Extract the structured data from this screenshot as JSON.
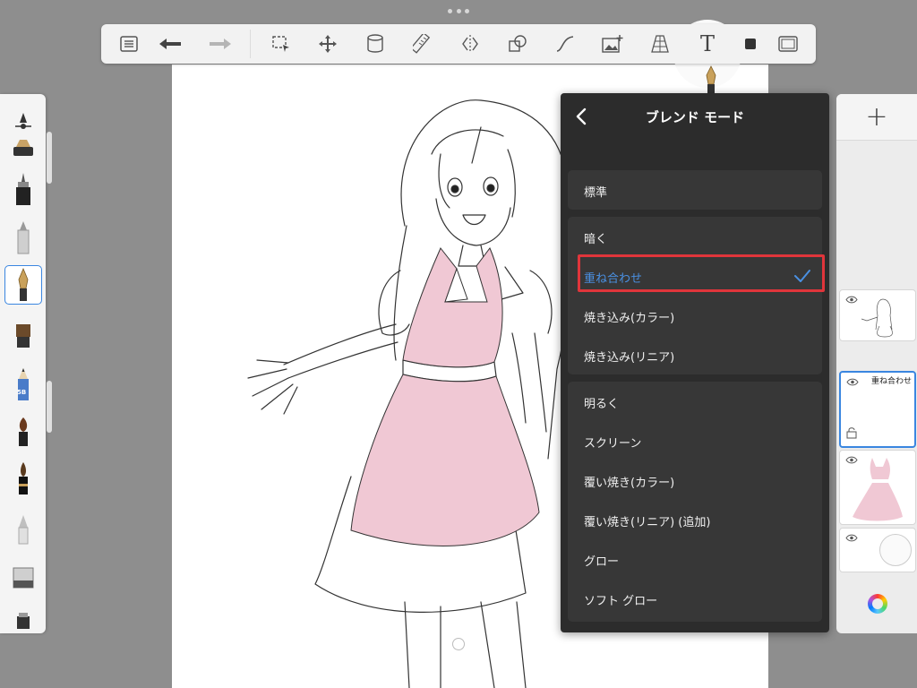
{
  "toolbar": {
    "tools": [
      {
        "name": "list-icon"
      },
      {
        "name": "undo-icon"
      },
      {
        "name": "redo-icon"
      },
      {
        "name": "selection-icon"
      },
      {
        "name": "transform-move-icon"
      },
      {
        "name": "fill-bucket-icon"
      },
      {
        "name": "ruler-icon"
      },
      {
        "name": "symmetry-icon"
      },
      {
        "name": "shapes-icon"
      },
      {
        "name": "curve-icon"
      },
      {
        "name": "add-image-icon"
      },
      {
        "name": "perspective-grid-icon"
      },
      {
        "name": "text-tool-icon",
        "label": "T"
      },
      {
        "name": "color-swatch-icon"
      },
      {
        "name": "fullscreen-icon"
      }
    ]
  },
  "brushes": [
    {
      "name": "brush-smudge"
    },
    {
      "name": "brush-ink-pen-black"
    },
    {
      "name": "brush-marker"
    },
    {
      "name": "brush-airbrush"
    },
    {
      "name": "brush-fountain-pen",
      "selected": true
    },
    {
      "name": "brush-flat-bristle"
    },
    {
      "name": "brush-pencil-5b",
      "label": "5B"
    },
    {
      "name": "brush-round-paint"
    },
    {
      "name": "brush-paint-dark"
    },
    {
      "name": "brush-blender"
    },
    {
      "name": "brush-eraser"
    }
  ],
  "blend_panel": {
    "title": "ブレンド モード",
    "groups": [
      {
        "items": [
          "標準"
        ]
      },
      {
        "items": [
          "暗く",
          "重ね合わせ",
          "焼き込み(カラー)",
          "焼き込み(リニア)"
        ]
      },
      {
        "items": [
          "明るく",
          "スクリーン",
          "覆い焼き(カラー)",
          "覆い焼き(リニア) (追加)",
          "グロー",
          "ソフト グロー"
        ]
      }
    ],
    "selected": "重ね合わせ",
    "accent_color": "#4a90e2",
    "highlight_color": "#e0353b"
  },
  "layers": {
    "add_label": "+",
    "items": [
      {
        "name": "line-art-layer",
        "label": ""
      },
      {
        "name": "multiply-layer",
        "label": "重ね合わせ",
        "active": true
      },
      {
        "name": "dress-color-layer",
        "label": ""
      },
      {
        "name": "paper-layer",
        "label": ""
      }
    ]
  },
  "colors": {
    "dress_fill": "#f0c8d4",
    "panel_bg": "#2c2c2c",
    "selection_blue": "#3a86e0"
  }
}
